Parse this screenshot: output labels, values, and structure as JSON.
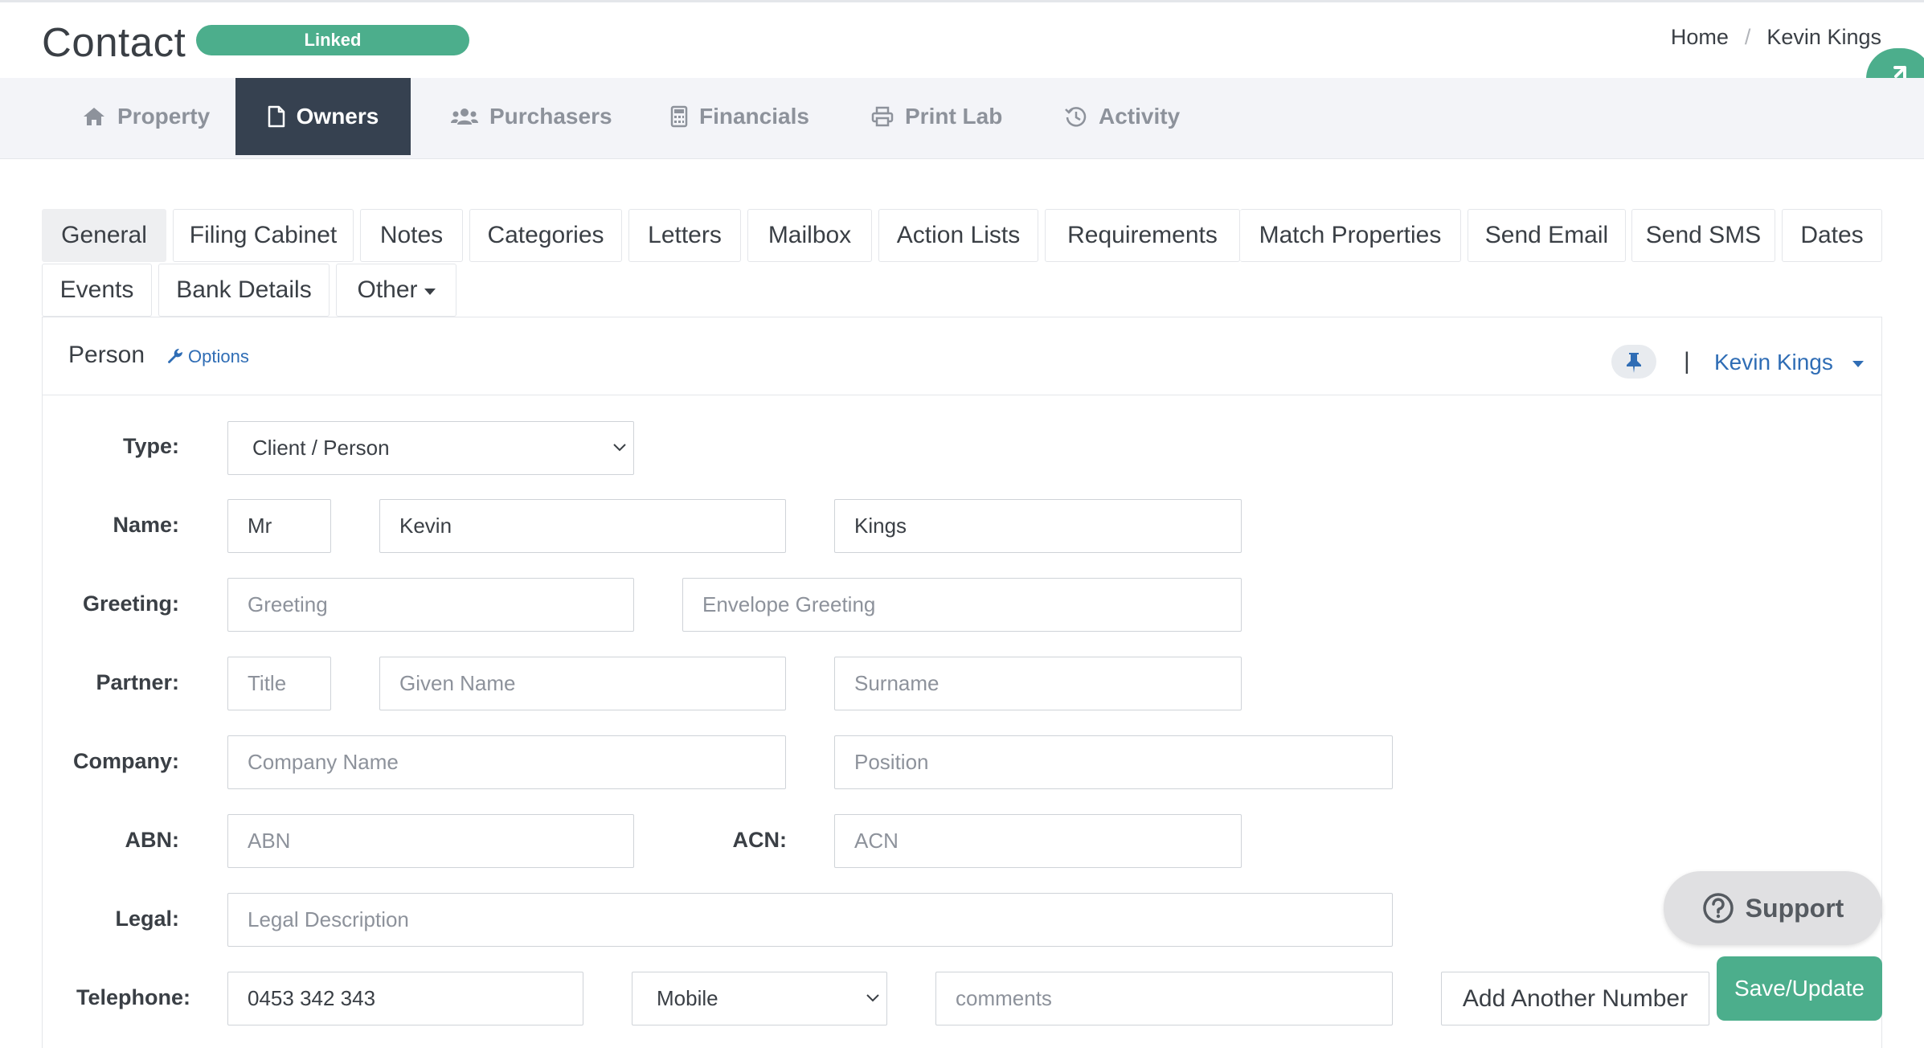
{
  "header": {
    "title": "Contact",
    "badge": "Linked",
    "breadcrumb": [
      "Home",
      "Kevin Kings"
    ]
  },
  "main_tabs": [
    {
      "label": "Property",
      "icon": "home-icon",
      "active": false
    },
    {
      "label": "Owners",
      "icon": "file-icon",
      "active": true
    },
    {
      "label": "Purchasers",
      "icon": "users-icon",
      "active": false
    },
    {
      "label": "Financials",
      "icon": "calculator-icon",
      "active": false
    },
    {
      "label": "Print Lab",
      "icon": "printer-icon",
      "active": false
    },
    {
      "label": "Activity",
      "icon": "history-icon",
      "active": false
    }
  ],
  "sub_tabs": [
    "General",
    "Filing Cabinet",
    "Notes",
    "Categories",
    "Letters",
    "Mailbox",
    "Action Lists",
    "Requirements",
    "Match Properties",
    "Send Email",
    "Send SMS",
    "Dates",
    "Events",
    "Bank Details",
    "Other"
  ],
  "panel": {
    "title": "Person",
    "options_label": "Options",
    "person_selector": "Kevin Kings",
    "divider": "|"
  },
  "form": {
    "type_label": "Type:",
    "type_value": "Client / Person",
    "name_label": "Name:",
    "name_title": "Mr",
    "name_given": "Kevin",
    "name_surname": "Kings",
    "greeting_label": "Greeting:",
    "greeting_placeholder": "Greeting",
    "envelope_placeholder": "Envelope Greeting",
    "partner_label": "Partner:",
    "partner_title_placeholder": "Title",
    "partner_given_placeholder": "Given Name",
    "partner_surname_placeholder": "Surname",
    "company_label": "Company:",
    "company_placeholder": "Company Name",
    "position_placeholder": "Position",
    "abn_label": "ABN:",
    "abn_placeholder": "ABN",
    "acn_label": "ACN:",
    "acn_placeholder": "ACN",
    "legal_label": "Legal:",
    "legal_placeholder": "Legal Description",
    "telephone_label": "Telephone:",
    "telephone_value": "0453 342 343",
    "phone_type": "Mobile",
    "comments_placeholder": "comments",
    "add_number_label": "Add Another Number"
  },
  "support_label": "Support",
  "save_label": "Save/Update",
  "colors": {
    "accent_green": "#4cae8c",
    "nav_active": "#364150",
    "link_blue": "#2f6db5"
  }
}
